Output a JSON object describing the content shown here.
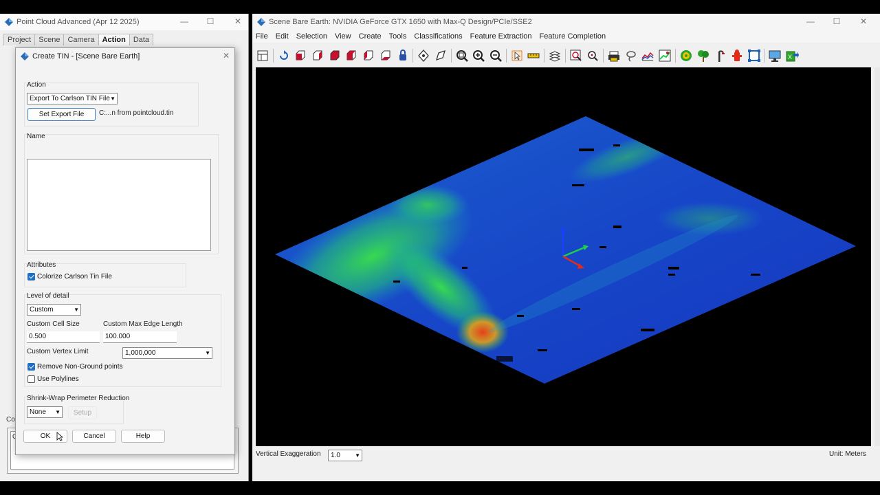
{
  "left_window": {
    "title": "Point Cloud Advanced (Apr 12 2025)",
    "tabs": [
      {
        "label": "Project",
        "active": false
      },
      {
        "label": "Scene",
        "active": false
      },
      {
        "label": "Camera",
        "active": false
      },
      {
        "label": "Action",
        "active": true
      },
      {
        "label": "Data",
        "active": false
      }
    ],
    "bottom_label": "Co",
    "bottom_text": "O"
  },
  "dialog": {
    "title": "Create TIN - [Scene Bare Earth]",
    "action": {
      "label": "Action",
      "selected": "Export To Carlson TIN File",
      "set_export_button": "Set Export File",
      "export_path": "C:...n from pointcloud.tin"
    },
    "name": {
      "label": "Name",
      "value": ""
    },
    "attributes": {
      "label": "Attributes",
      "colorize_label": "Colorize Carlson Tin File",
      "colorize_checked": true
    },
    "lod": {
      "label": "Level of detail",
      "selected": "Custom",
      "cell_size_label": "Custom Cell Size",
      "cell_size_value": "0.500",
      "max_edge_label": "Custom Max Edge Length",
      "max_edge_value": "100.000",
      "vertex_limit_label": "Custom Vertex Limit",
      "vertex_limit_value": "1,000,000",
      "remove_ground_label": "Remove Non-Ground points",
      "remove_ground_checked": true,
      "polylines_label": "Use Polylines",
      "polylines_checked": false
    },
    "shrink": {
      "label": "Shrink-Wrap Perimeter Reduction",
      "selected": "None",
      "setup_button": "Setup"
    },
    "buttons": {
      "ok": "OK",
      "cancel": "Cancel",
      "help": "Help"
    }
  },
  "right_window": {
    "title": "Scene Bare Earth: NVIDIA GeForce GTX 1650 with Max-Q Design/PCIe/SSE2",
    "menu": [
      "File",
      "Edit",
      "Selection",
      "View",
      "Create",
      "Tools",
      "Classifications",
      "Feature Extraction",
      "Feature Completion"
    ],
    "toolbar_icons": [
      "layers-icon",
      "rotate-icon",
      "view-front-icon",
      "view-side-icon",
      "view-top-icon",
      "view-back-icon",
      "view-left-icon",
      "view-right-icon",
      "lock-icon",
      "pan-icon",
      "select-icon",
      "zoom-extents-icon",
      "zoom-in-icon",
      "zoom-out-icon",
      "pointer-icon",
      "measure-icon",
      "stack-icon",
      "zoom-window-icon",
      "zoom-point-icon",
      "printer-icon",
      "lasso-icon",
      "profile-icon",
      "classify-icon",
      "target-icon",
      "tree-icon",
      "pole-icon",
      "hydrant-icon",
      "frame-icon",
      "monitor-icon",
      "export-icon"
    ],
    "vertical_exaggeration_label": "Vertical Exaggeration",
    "vertical_exaggeration_value": "1.0",
    "unit_label": "Unit: Meters"
  },
  "colors": {
    "accent": "#1f6fc3",
    "terrain_low": "#1a3fc8",
    "terrain_mid": "#1fcf4a",
    "terrain_high": "#e0401a"
  }
}
